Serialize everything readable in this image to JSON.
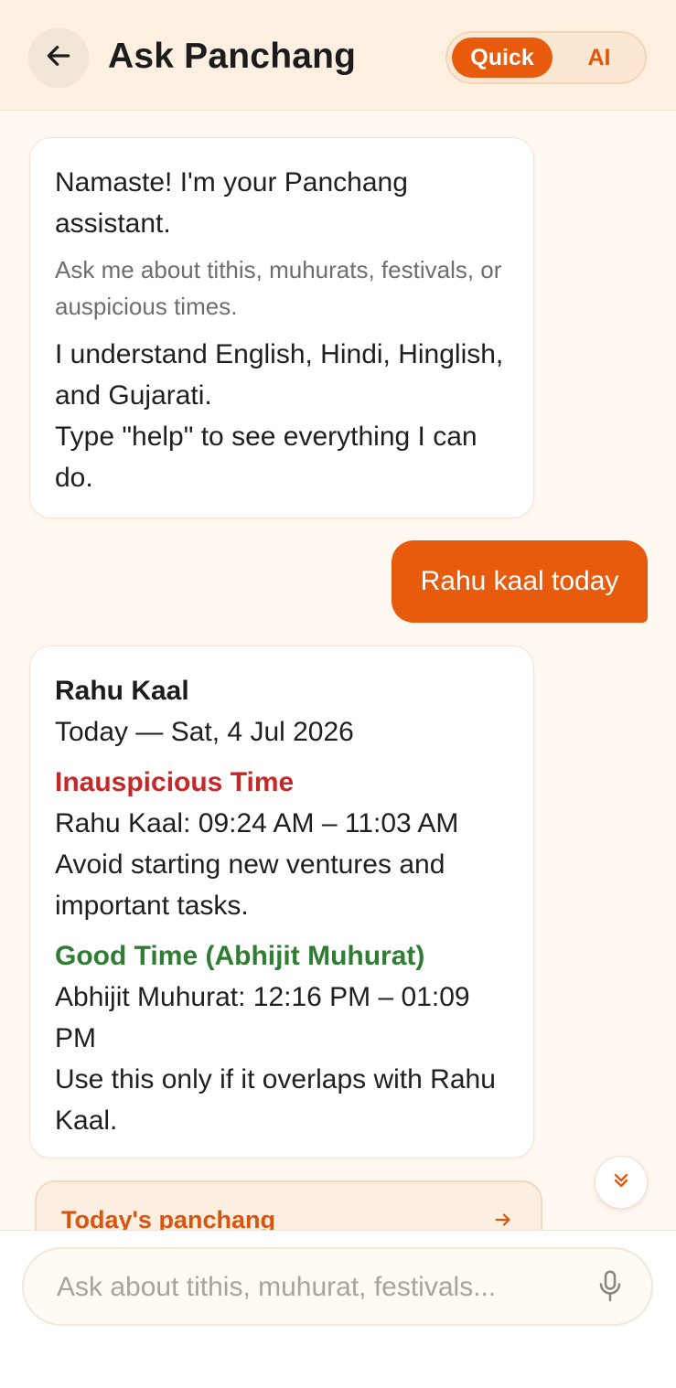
{
  "header": {
    "title": "Ask Panchang",
    "mode_toggle": {
      "quick_label": "Quick",
      "ai_label": "AI",
      "selected": "Quick"
    }
  },
  "messages": {
    "welcome": {
      "greeting": "Namaste! I'm your Panchang assistant.",
      "subtitle": "Ask me about tithis, muhurats, festivals, or auspicious times.",
      "languages": "I understand English, Hindi, Hinglish, and Gujarati.",
      "help_hint": "Type \"help\" to see everything I can do."
    },
    "user_query": "Rahu kaal today",
    "response": {
      "title": "Rahu Kaal",
      "date_line": "Today — Sat, 4 Jul 2026",
      "inauspicious_heading": "Inauspicious Time",
      "rahu_kaal_time": "Rahu Kaal: 09:24 AM – 11:03 AM",
      "rahu_kaal_advice": "Avoid starting new ventures and important tasks.",
      "good_time_heading": "Good Time (Abhijit Muhurat)",
      "abhijit_time": "Abhijit Muhurat: 12:16 PM – 01:09 PM",
      "abhijit_advice": "Use this only if it overlaps with Rahu Kaal."
    }
  },
  "suggestion": {
    "label": "Today's panchang"
  },
  "composer": {
    "placeholder": "Ask about tithis, muhurat, festivals...",
    "value": ""
  },
  "colors": {
    "accent": "#e85a0c",
    "header_bg": "#fdf0e0",
    "page_bg": "#fff9f2",
    "inauspicious": "#c62828",
    "auspicious": "#2e7d32"
  },
  "icons": {
    "back": "arrow-left-icon",
    "suggestion": "arrow-right-icon",
    "scroll": "double-chevron-down-icon",
    "mic": "microphone-icon"
  }
}
